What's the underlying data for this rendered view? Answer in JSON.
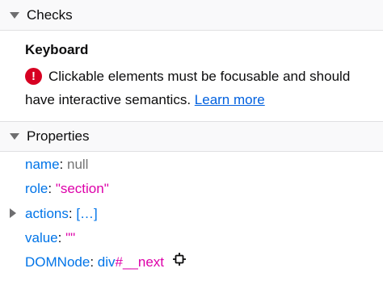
{
  "checks": {
    "header": "Checks",
    "title": "Keyboard",
    "message_line1": "Clickable elements must be focusable and should",
    "message_line2": "have interactive semantics.",
    "learn_more": "Learn more",
    "error_glyph": "!"
  },
  "properties": {
    "header": "Properties",
    "name": {
      "key": "name",
      "value": "null"
    },
    "role": {
      "key": "role",
      "value": "\"section\""
    },
    "actions": {
      "key": "actions",
      "value": "[…]"
    },
    "value": {
      "key": "value",
      "value": "\"\""
    },
    "domnode": {
      "key": "DOMNode",
      "tag": "div",
      "id": "#__next",
      "icon": "target-node-icon"
    }
  },
  "colors": {
    "error": "#d70022",
    "link": "#0060df",
    "key": "#0074e8",
    "string": "#dd00a9",
    "null": "#737373"
  }
}
